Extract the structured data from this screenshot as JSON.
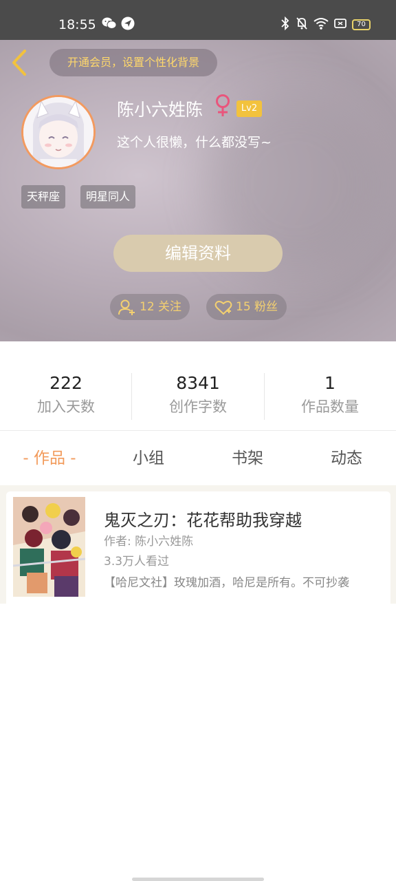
{
  "status_bar": {
    "time": "18:55",
    "battery": "70",
    "icons": [
      "wechat-icon",
      "navigation-icon",
      "bluetooth-icon",
      "bell-mute-icon",
      "wifi-icon",
      "sim-icon"
    ]
  },
  "header": {
    "back_icon": "chevron-left-icon",
    "vip_banner": "开通会员，设置个性化背景"
  },
  "profile": {
    "username": "陈小六姓陈",
    "gender_icon": "female-icon",
    "gender_color": "#e9557c",
    "level": "Lv2",
    "bio": "这个人很懒，什么都没写~",
    "tags": [
      "天秤座",
      "明星同人"
    ],
    "edit_button": "编辑资料",
    "follow": "12 关注",
    "fans": "15 粉丝"
  },
  "stats": [
    {
      "value": "222",
      "label": "加入天数"
    },
    {
      "value": "8341",
      "label": "创作字数"
    },
    {
      "value": "1",
      "label": "作品数量"
    }
  ],
  "tabs": [
    {
      "label": "- 作品 -",
      "active": true
    },
    {
      "label": "小组",
      "active": false
    },
    {
      "label": "书架",
      "active": false
    },
    {
      "label": "动态",
      "active": false
    }
  ],
  "works": [
    {
      "title": "鬼灭之刃：花花帮助我穿越",
      "author": "作者: 陈小六姓陈",
      "views": "3.3万人看过",
      "description": "【哈尼文社】玫瑰加酒，哈尼是所有。不可抄袭"
    }
  ],
  "colors": {
    "accent": "#f29a5a",
    "level_badge": "#f2c23d",
    "stat_value": "#222222"
  }
}
